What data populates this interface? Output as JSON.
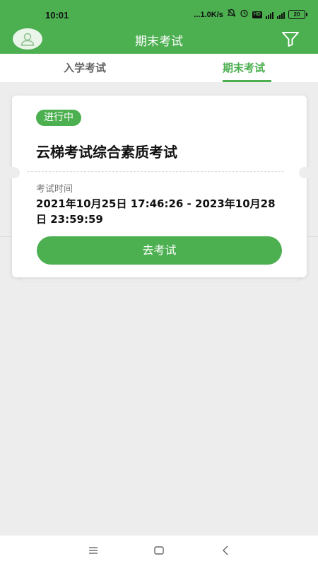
{
  "status_bar": {
    "time": "10:01",
    "net_speed": "...1.0K/s",
    "network": "4G",
    "battery": "20"
  },
  "header": {
    "title": "期末考试"
  },
  "tabs": [
    {
      "label": "入学考试",
      "active": false
    },
    {
      "label": "期末考试",
      "active": true
    }
  ],
  "card": {
    "status_badge": "进行中",
    "title": "云梯考试综合素质考试",
    "time_label": "考试时间",
    "time_value": "2021年10月25日 17:46:26 - 2023年10月28日 23:59:59",
    "action_button": "去考试"
  },
  "colors": {
    "accent": "#4caf50",
    "background": "#ededed"
  }
}
